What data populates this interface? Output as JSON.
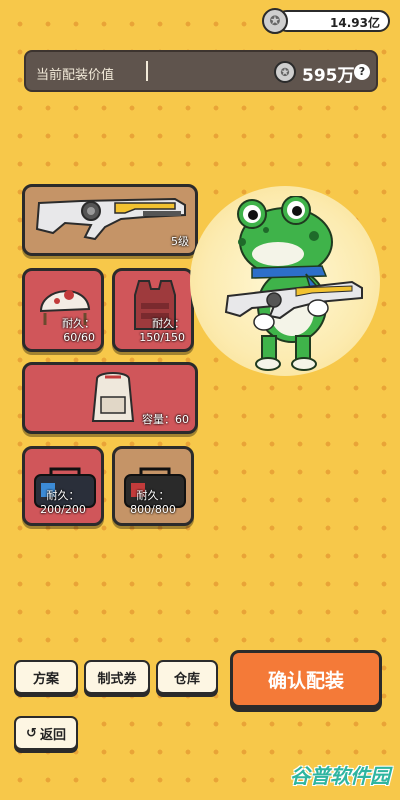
{
  "currency": {
    "amount": "14.93亿",
    "icon": "silver-coin-icon"
  },
  "value_bar": {
    "label": "当前配装价值",
    "amount": "595万",
    "help": "?"
  },
  "slots": {
    "weapon": {
      "level": "5级"
    },
    "helmet": {
      "durability_label": "耐久：",
      "durability": "60/60"
    },
    "armor": {
      "durability_label": "耐久：",
      "durability": "150/150"
    },
    "backpack": {
      "capacity": "容量：60"
    },
    "bag_left": {
      "durability_label": "耐久：",
      "durability": "200/200"
    },
    "bag_right": {
      "durability_label": "耐久：",
      "durability": "800/800"
    }
  },
  "buttons": {
    "plan": "方案",
    "ticket": "制式券",
    "warehouse": "仓库",
    "confirm": "确认配装",
    "back": "返回"
  },
  "watermark": "谷普软件园",
  "colors": {
    "background": "#f7c84a",
    "confirm": "#f47a38",
    "slot_red": "#d0565a",
    "slot_tan": "#c59467"
  }
}
